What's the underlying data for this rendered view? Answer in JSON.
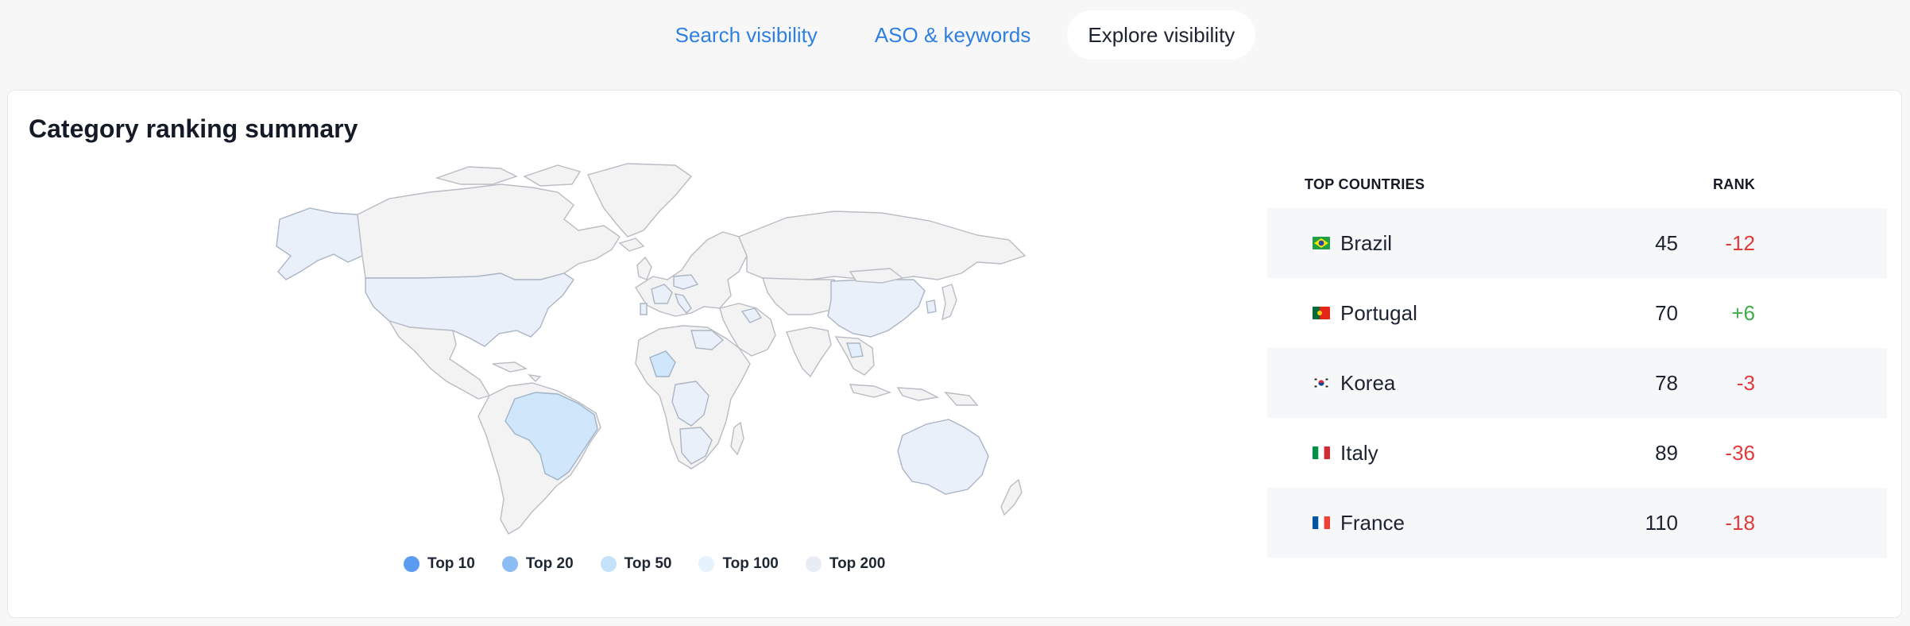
{
  "tabs": [
    {
      "label": "Search visibility",
      "active": false
    },
    {
      "label": "ASO & keywords",
      "active": false
    },
    {
      "label": "Explore visibility",
      "active": true
    }
  ],
  "card": {
    "title": "Category ranking summary"
  },
  "map": {
    "legend": [
      {
        "label": "Top 10",
        "color": "#5b9cf2"
      },
      {
        "label": "Top 20",
        "color": "#8cbdf2"
      },
      {
        "label": "Top 50",
        "color": "#c5e2fb"
      },
      {
        "label": "Top 100",
        "color": "#e6f2fd"
      },
      {
        "label": "Top 200",
        "color": "#e8edf5"
      }
    ]
  },
  "table": {
    "header_country": "TOP COUNTRIES",
    "header_rank": "RANK",
    "rows": [
      {
        "country": "Brazil",
        "flag": "brazil-flag-icon",
        "rank": "45",
        "change": "-12",
        "trend": "down"
      },
      {
        "country": "Portugal",
        "flag": "portugal-flag-icon",
        "rank": "70",
        "change": "+6",
        "trend": "up"
      },
      {
        "country": "Korea",
        "flag": "korea-flag-icon",
        "rank": "78",
        "change": "-3",
        "trend": "down"
      },
      {
        "country": "Italy",
        "flag": "italy-flag-icon",
        "rank": "89",
        "change": "-36",
        "trend": "down"
      },
      {
        "country": "France",
        "flag": "france-flag-icon",
        "rank": "110",
        "change": "-18",
        "trend": "down"
      }
    ]
  },
  "colors": {
    "accent": "#2f7fe0",
    "negative": "#e03b3b",
    "positive": "#3fae49"
  }
}
